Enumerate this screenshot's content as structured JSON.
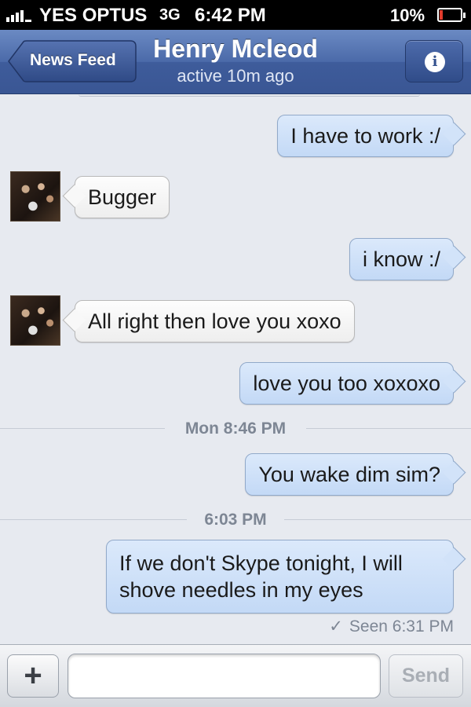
{
  "status_bar": {
    "carrier": "YES OPTUS",
    "network": "3G",
    "time": "6:42 PM",
    "battery_percent": "10%",
    "battery_level": 0.1,
    "battery_color": "#e23b2c",
    "signal_bars": 5
  },
  "nav": {
    "back_label": "News Feed",
    "title": "Henry Mcleod",
    "subtitle": "active 10m ago",
    "info_icon": "info-icon",
    "brand_color": "#3e5c9b"
  },
  "messages": [
    {
      "direction": "out",
      "text": "I have to work :/"
    },
    {
      "direction": "in",
      "text": "Bugger"
    },
    {
      "direction": "out",
      "text": "i know :/"
    },
    {
      "direction": "in",
      "text": "All right then love you xoxo"
    },
    {
      "direction": "out",
      "text": "love you too xoxoxo"
    },
    {
      "separator": "Mon 8:46 PM"
    },
    {
      "direction": "out",
      "text": "You wake dim sim?"
    },
    {
      "separator": "6:03 PM"
    },
    {
      "direction": "out",
      "text": "If we don't Skype tonight, I will shove needles in my eyes"
    }
  ],
  "seen": {
    "icon": "check-icon",
    "text": "Seen 6:31 PM"
  },
  "composer": {
    "plus_label": "+",
    "input_value": "",
    "input_placeholder": "",
    "send_label": "Send"
  }
}
